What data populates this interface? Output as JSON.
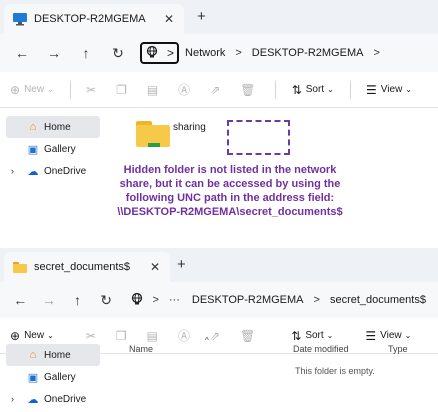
{
  "annotation": {
    "text": "Hidden folder is not listed in the network\nshare, but it can be accessed by using the\nfollowing UNC path in the address field:\n\\\\DESKTOP-R2MGEMA\\secret_documents$"
  },
  "top_window": {
    "tab_title": "DESKTOP-R2MGEMA",
    "tab_close": "✕",
    "new_tab": "+",
    "nav": {
      "back": "←",
      "forward": "→",
      "up": "↑",
      "refresh": "↻",
      "more": ">"
    },
    "breadcrumb": [
      "Network",
      "DESKTOP-R2MGEMA"
    ],
    "toolbar": {
      "new_label": "New",
      "sort_label": "Sort",
      "view_label": "View"
    },
    "sidebar": [
      {
        "label": "Home"
      },
      {
        "label": "Gallery"
      },
      {
        "label": "OneDrive"
      }
    ],
    "folder_label": "sharing"
  },
  "bottom_window": {
    "tab_title": "secret_documents$",
    "tab_close": "✕",
    "new_tab": "+",
    "nav": {
      "back": "←",
      "forward": "→",
      "up": "↑",
      "refresh": "↻",
      "ellipsis": "···"
    },
    "breadcrumb": [
      "DESKTOP-R2MGEMA",
      "secret_documents$"
    ],
    "toolbar": {
      "new_label": "New",
      "sort_label": "Sort",
      "view_label": "View",
      "more": "···"
    },
    "sidebar": [
      {
        "label": "Home"
      },
      {
        "label": "Gallery"
      },
      {
        "label": "OneDrive"
      }
    ],
    "columns": {
      "name": "Name",
      "date_modified": "Date modified",
      "type": "Type"
    },
    "empty_message": "This folder is empty."
  },
  "colors": {
    "annotation": "#7030a0",
    "folder": "#f7c948",
    "onedrive": "#0a64d6"
  }
}
